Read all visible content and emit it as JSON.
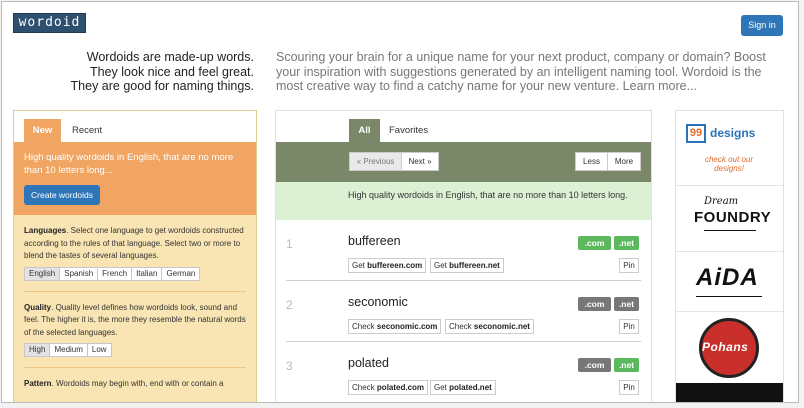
{
  "header": {
    "logo_text": "wordoid",
    "signin_label": "Sign in",
    "tagline_left": [
      "Wordoids are made-up words.",
      "They look nice and feel great.",
      "They are good for naming things."
    ],
    "tagline_right": "Scouring your brain for a unique name for your next product, company or domain? Boost your inspiration with suggestions generated by an intelligent naming tool. Wordoid is the most creative way to find a catchy name for your new venture. Learn more..."
  },
  "left_panel": {
    "tabs": [
      "New",
      "Recent"
    ],
    "active_tab": "New",
    "description": "High quality wordoids in English, that are no more than 10 letters long...",
    "create_label": "Create wordoids",
    "languages": {
      "title": "Languages",
      "text": ". Select one language to get wordoids constructed according to the rules of that language. Select two or more to blend the tastes of several languages.",
      "options": [
        "English",
        "Spanish",
        "French",
        "Italian",
        "German"
      ],
      "selected": "English"
    },
    "quality": {
      "title": "Quality",
      "text": ". Quality level defines how wordoids look, sound and feel. The higher it is, the more they resemble the natural words of the selected languages.",
      "options": [
        "High",
        "Medium",
        "Low"
      ],
      "selected": "High"
    },
    "pattern": {
      "title": "Pattern",
      "text": ". Wordoids may begin with, end with or contain a"
    }
  },
  "center_panel": {
    "tabs": [
      "All",
      "Favorites"
    ],
    "active_tab": "All",
    "pager": {
      "previous": "« Previous",
      "next": "Next »",
      "less": "Less",
      "more": "More"
    },
    "info": "High quality wordoids in English, that are no more than 10 letters long.",
    "results": [
      {
        "num": "1",
        "word": "buffereen",
        "com_prefix": "Get",
        "net_prefix": "Get",
        "com_domain": "buffereen.com",
        "net_domain": "buffereen.net",
        "com_label": ".com",
        "net_label": ".net",
        "com_status": "available",
        "net_status": "available",
        "pin": "Pin"
      },
      {
        "num": "2",
        "word": "seconomic",
        "com_prefix": "Check",
        "net_prefix": "Check",
        "com_domain": "seconomic.com",
        "net_domain": "seconomic.net",
        "com_label": ".com",
        "net_label": ".net",
        "com_status": "taken",
        "net_status": "taken",
        "pin": "Pin"
      },
      {
        "num": "3",
        "word": "polated",
        "com_prefix": "Check",
        "net_prefix": "Get",
        "com_domain": "polated.com",
        "net_domain": "polated.net",
        "com_label": ".com",
        "net_label": ".net",
        "com_status": "taken",
        "net_status": "available",
        "pin": "Pin"
      }
    ]
  },
  "ads": {
    "ad1_number": "99",
    "ad1_name": "designs",
    "ad1_tagline": "check out our designs!",
    "ad2_top": "Dream",
    "ad2_main": "FOUNDRY",
    "ad3_main": "AiDA",
    "ad4_main": "Pohans"
  },
  "colors": {
    "brand_blue": "#2f76b9",
    "orange": "#f0a563",
    "olive": "#7b8769",
    "available_green": "#5cb85c",
    "taken_gray": "#777777"
  }
}
